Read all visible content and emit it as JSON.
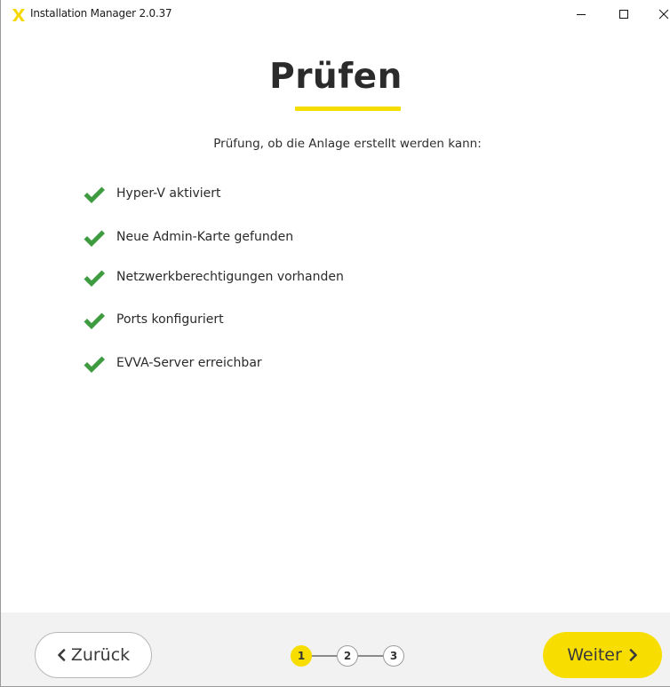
{
  "window": {
    "title": "Installation Manager 2.0.37",
    "controls": [
      "minimize-icon",
      "maximize-icon",
      "close-icon"
    ]
  },
  "page": {
    "title": "Prüfen",
    "subtitle": "Prüfung, ob die Anlage erstellt werden kann:"
  },
  "checks": [
    {
      "label": "Hyper-V aktiviert",
      "status": "ok",
      "icon": "checkmark-icon"
    },
    {
      "label": "Neue Admin-Karte gefunden",
      "status": "ok",
      "icon": "checkmark-icon"
    },
    {
      "label": "Netzwerkberechtigungen vorhanden",
      "status": "ok",
      "icon": "checkmark-icon"
    },
    {
      "label": "Ports konfiguriert",
      "status": "ok",
      "icon": "checkmark-icon"
    },
    {
      "label": "EVVA-Server erreichbar",
      "status": "ok",
      "icon": "checkmark-icon"
    }
  ],
  "footer": {
    "back_label": "Zurück",
    "next_label": "Weiter",
    "steps": [
      "1",
      "2",
      "3"
    ],
    "current_step": 1
  },
  "colors": {
    "accent": "#f7de00",
    "check_green": "#3f9b40",
    "text": "#2b2b2b",
    "footer_bg": "#f2f2f2"
  }
}
